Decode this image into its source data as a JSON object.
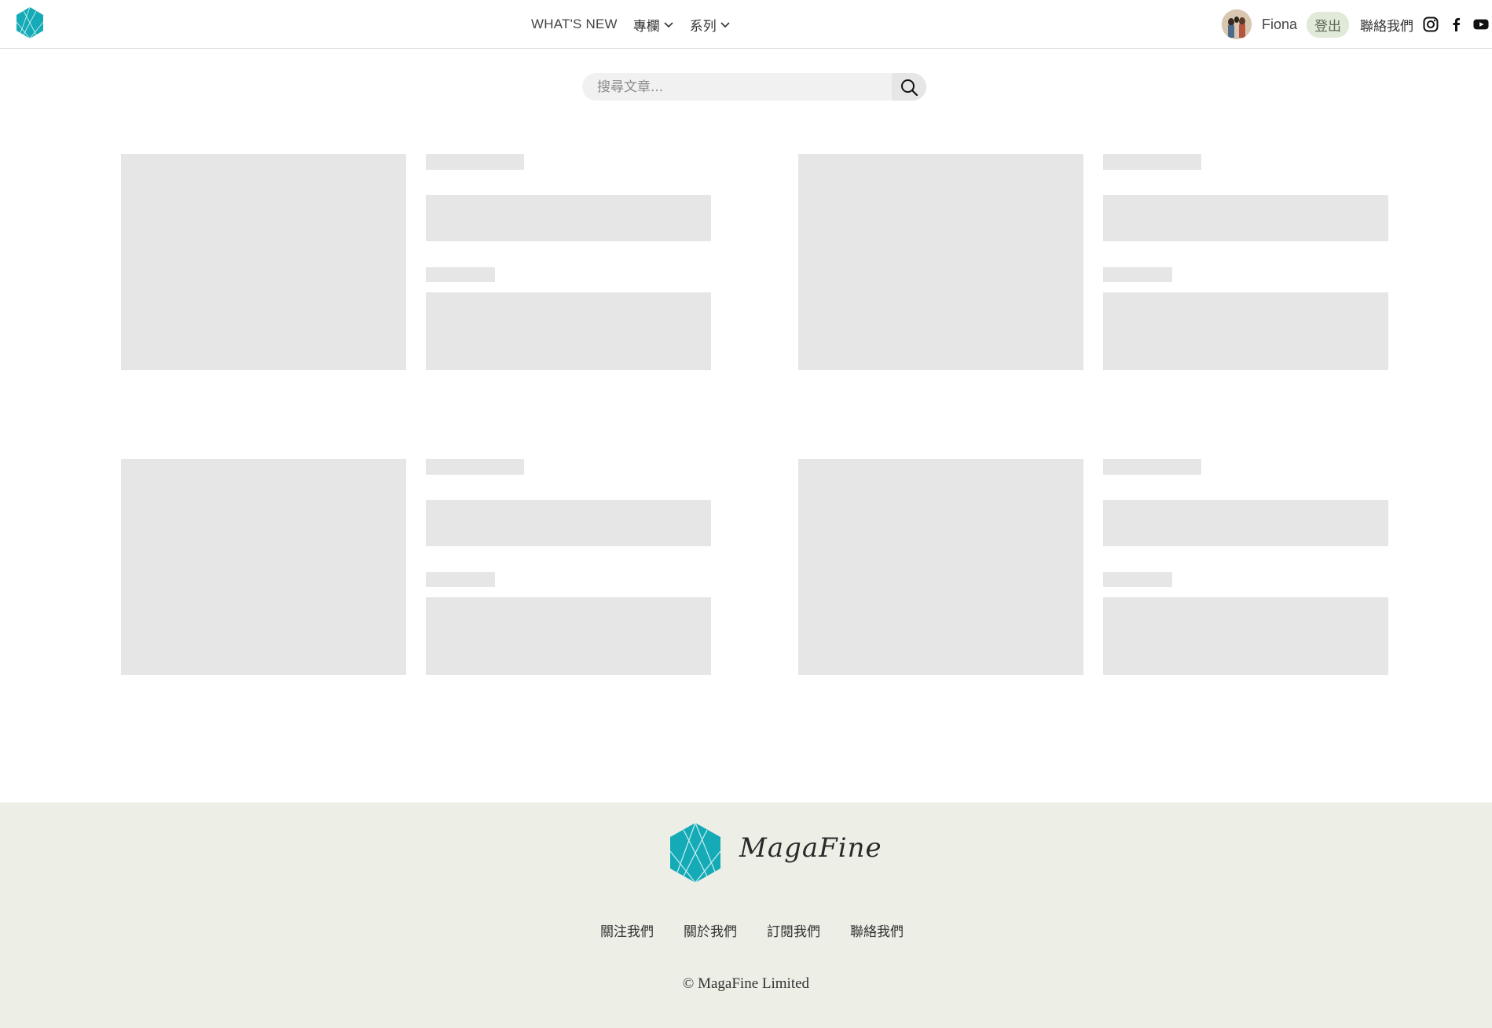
{
  "header": {
    "nav": {
      "whats_new": "WHAT'S NEW",
      "columns": "專欄",
      "series": "系列"
    },
    "user": {
      "name": "Fiona",
      "logout": "登出"
    },
    "contact": "聯絡我們",
    "social_icons": [
      "instagram-icon",
      "facebook-icon",
      "youtube-icon"
    ]
  },
  "search": {
    "placeholder": "搜尋文章..."
  },
  "content": {
    "skeleton_card_count": 4
  },
  "footer": {
    "brand": "MagaFine",
    "links": [
      "關注我們",
      "關於我們",
      "訂閱我們",
      "聯絡我們"
    ],
    "copyright": "© MagaFine Limited"
  },
  "colors": {
    "brand_teal": "#14aab6",
    "skeleton": "#e6e6e6",
    "footer_bg": "#edefe7",
    "logout_bg": "#e1e9d8"
  }
}
